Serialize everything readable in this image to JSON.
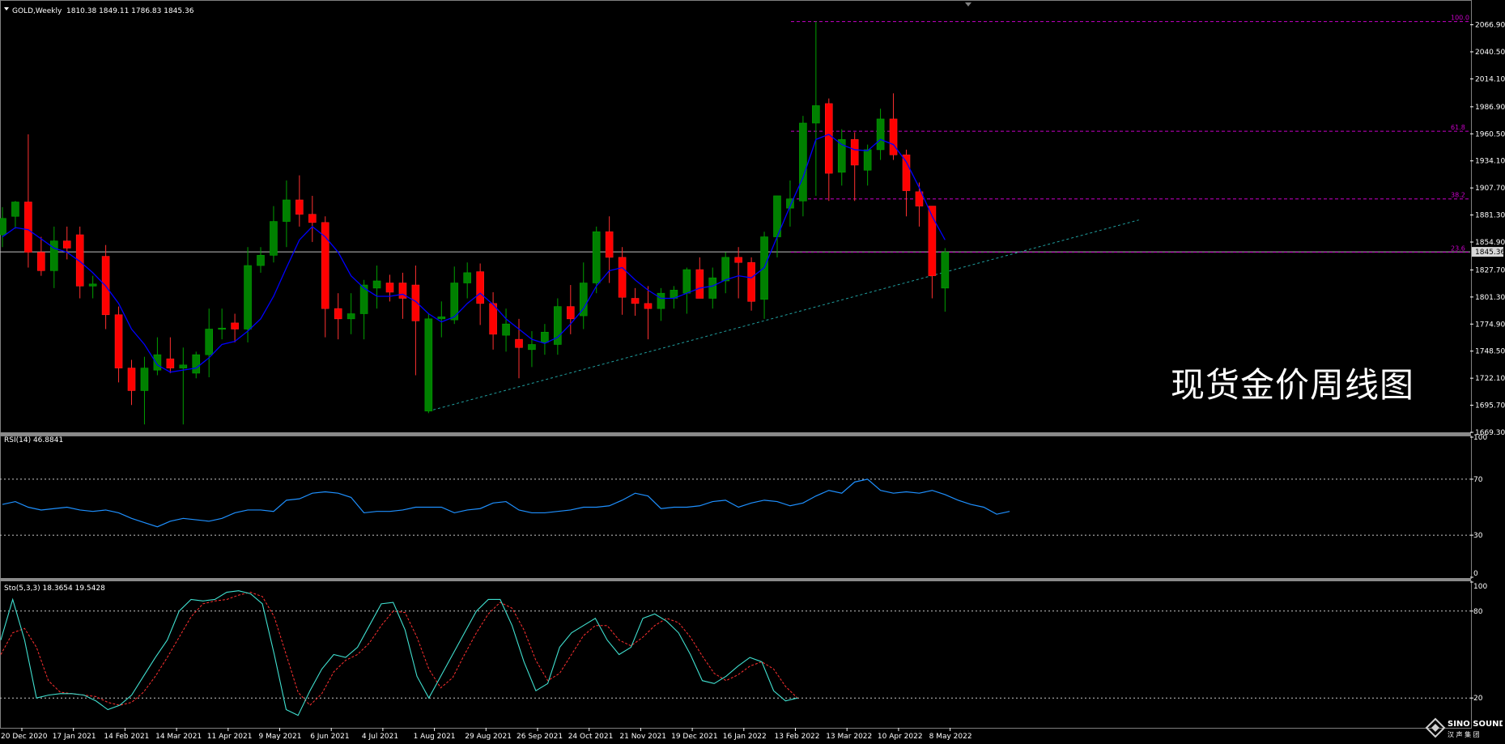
{
  "header": {
    "symbol_label": "GOLD,Weekly",
    "ohlc_label": "1810.38 1849.11 1786.83 1845.36"
  },
  "watermark": "现货金价周线图",
  "logo": {
    "text": "SINO SOUND",
    "subtext": "汉 声 集 团"
  },
  "colors": {
    "background": "#000000",
    "bull_candle": "#008000",
    "bear_candle": "#ff0000",
    "ma_line": "#0000ff",
    "fib_line": "#c800c8",
    "trend_line": "#20a0a0",
    "rsi_line": "#1e90ff",
    "stoch_main": "#40e0d0",
    "stoch_signal": "#ff3030",
    "axis_text": "#ffffff",
    "price_marker": "#c0c0c0"
  },
  "chart_data": [
    {
      "type": "candlestick",
      "panel": "price",
      "ylim": [
        1669.3,
        2080
      ],
      "yticks": [
        "2066.90",
        "2040.50",
        "2014.10",
        "1986.90",
        "1960.50",
        "1934.10",
        "1907.70",
        "1881.30",
        "1854.90",
        "1827.70",
        "1801.30",
        "1774.90",
        "1748.50",
        "1722.10",
        "1695.70",
        "1669.30"
      ],
      "current_price": "1845.36",
      "xticks": [
        "20 Dec 2020",
        "17 Jan 2021",
        "14 Feb 2021",
        "14 Mar 2021",
        "11 Apr 2021",
        "9 May 2021",
        "6 Jun 2021",
        "4 Jul 2021",
        "1 Aug 2021",
        "29 Aug 2021",
        "26 Sep 2021",
        "24 Oct 2021",
        "21 Nov 2021",
        "19 Dec 2021",
        "16 Jan 2022",
        "13 Feb 2022",
        "13 Mar 2022",
        "10 Apr 2022",
        "8 May 2022"
      ],
      "ohlc": [
        [
          1862,
          1889,
          1850,
          1878
        ],
        [
          1880,
          1895,
          1868,
          1894
        ],
        [
          1894,
          1960,
          1830,
          1845
        ],
        [
          1845,
          1860,
          1822,
          1827
        ],
        [
          1827,
          1870,
          1810,
          1856
        ],
        [
          1856,
          1870,
          1838,
          1849
        ],
        [
          1862,
          1870,
          1800,
          1812
        ],
        [
          1812,
          1822,
          1800,
          1814
        ],
        [
          1841,
          1852,
          1770,
          1784
        ],
        [
          1784,
          1792,
          1718,
          1732
        ],
        [
          1732,
          1740,
          1696,
          1710
        ],
        [
          1710,
          1743,
          1677,
          1732
        ],
        [
          1730,
          1762,
          1725,
          1745
        ],
        [
          1741,
          1762,
          1727,
          1732
        ],
        [
          1732,
          1752,
          1677,
          1735
        ],
        [
          1727,
          1748,
          1722,
          1745
        ],
        [
          1745,
          1790,
          1723,
          1770
        ],
        [
          1770,
          1790,
          1760,
          1771
        ],
        [
          1776,
          1785,
          1757,
          1770
        ],
        [
          1770,
          1850,
          1757,
          1832
        ],
        [
          1832,
          1850,
          1825,
          1842
        ],
        [
          1842,
          1890,
          1835,
          1875
        ],
        [
          1875,
          1915,
          1850,
          1896
        ],
        [
          1896,
          1920,
          1870,
          1882
        ],
        [
          1882,
          1900,
          1855,
          1874
        ],
        [
          1874,
          1880,
          1762,
          1790
        ],
        [
          1790,
          1805,
          1760,
          1780
        ],
        [
          1780,
          1805,
          1765,
          1785
        ],
        [
          1785,
          1818,
          1760,
          1813
        ],
        [
          1810,
          1832,
          1790,
          1817
        ],
        [
          1815,
          1823,
          1797,
          1806
        ],
        [
          1815,
          1825,
          1780,
          1800
        ],
        [
          1813,
          1832,
          1725,
          1778
        ],
        [
          1690,
          1785,
          1688,
          1780
        ],
        [
          1780,
          1797,
          1762,
          1782
        ],
        [
          1779,
          1831,
          1775,
          1815
        ],
        [
          1815,
          1835,
          1800,
          1825
        ],
        [
          1826,
          1834,
          1774,
          1795
        ],
        [
          1795,
          1806,
          1750,
          1765
        ],
        [
          1764,
          1790,
          1748,
          1775
        ],
        [
          1760,
          1780,
          1722,
          1752
        ],
        [
          1750,
          1768,
          1733,
          1755
        ],
        [
          1757,
          1775,
          1745,
          1767
        ],
        [
          1755,
          1800,
          1745,
          1792
        ],
        [
          1792,
          1813,
          1765,
          1780
        ],
        [
          1783,
          1835,
          1770,
          1815
        ],
        [
          1815,
          1870,
          1805,
          1865
        ],
        [
          1865,
          1880,
          1815,
          1840
        ],
        [
          1840,
          1850,
          1784,
          1801
        ],
        [
          1800,
          1810,
          1783,
          1795
        ],
        [
          1795,
          1812,
          1760,
          1790
        ],
        [
          1790,
          1810,
          1778,
          1805
        ],
        [
          1800,
          1812,
          1790,
          1808
        ],
        [
          1805,
          1830,
          1785,
          1828
        ],
        [
          1828,
          1840,
          1800,
          1800
        ],
        [
          1800,
          1830,
          1790,
          1820
        ],
        [
          1817,
          1845,
          1805,
          1840
        ],
        [
          1840,
          1850,
          1800,
          1835
        ],
        [
          1835,
          1840,
          1788,
          1797
        ],
        [
          1799,
          1865,
          1780,
          1860
        ],
        [
          1860,
          1900,
          1840,
          1900
        ],
        [
          1888,
          1915,
          1870,
          1897
        ],
        [
          1895,
          1978,
          1880,
          1971
        ],
        [
          1971,
          2070,
          1900,
          1988
        ],
        [
          1990,
          1995,
          1895,
          1922
        ],
        [
          1923,
          1965,
          1910,
          1955
        ],
        [
          1955,
          1962,
          1895,
          1930
        ],
        [
          1925,
          1950,
          1910,
          1945
        ],
        [
          1945,
          1985,
          1935,
          1975
        ],
        [
          1975,
          2000,
          1935,
          1940
        ],
        [
          1940,
          1945,
          1880,
          1905
        ],
        [
          1904,
          1913,
          1870,
          1890
        ],
        [
          1890,
          1890,
          1800,
          1822
        ],
        [
          1810,
          1849,
          1787,
          1845
        ]
      ],
      "ma": [
        1860,
        1869,
        1867,
        1858,
        1849,
        1845,
        1836,
        1825,
        1812,
        1795,
        1770,
        1755,
        1735,
        1728,
        1730,
        1732,
        1742,
        1755,
        1758,
        1768,
        1780,
        1802,
        1830,
        1857,
        1870,
        1860,
        1845,
        1822,
        1810,
        1802,
        1802,
        1804,
        1797,
        1785,
        1777,
        1782,
        1795,
        1805,
        1794,
        1780,
        1770,
        1760,
        1756,
        1762,
        1775,
        1790,
        1812,
        1827,
        1830,
        1818,
        1808,
        1800,
        1800,
        1805,
        1810,
        1812,
        1818,
        1822,
        1820,
        1830,
        1860,
        1890,
        1918,
        1955,
        1960,
        1950,
        1945,
        1944,
        1955,
        1950,
        1933,
        1908,
        1880,
        1857
      ],
      "fib_levels": [
        {
          "label": "100.0",
          "price": 2070
        },
        {
          "label": "61.8",
          "price": 1963
        },
        {
          "label": "38.2",
          "price": 1897
        },
        {
          "label": "23.6",
          "price": 1845
        }
      ],
      "trendline": {
        "from": [
          33,
          1690
        ],
        "to": [
          85,
          1882
        ]
      }
    },
    {
      "type": "line",
      "panel": "rsi",
      "label": "RSI(14) 46.8841",
      "ylim": [
        0,
        100
      ],
      "yticks": [
        "100",
        "70",
        "30",
        "0"
      ],
      "levels": [
        70,
        30
      ],
      "values": [
        52,
        54,
        50,
        48,
        49,
        50,
        48,
        47,
        48,
        46,
        42,
        39,
        36,
        40,
        42,
        41,
        40,
        42,
        46,
        48,
        48,
        47,
        55,
        56,
        60,
        61,
        60,
        57,
        46,
        47,
        47,
        48,
        50,
        50,
        50,
        46,
        48,
        49,
        53,
        54,
        48,
        46,
        46,
        47,
        48,
        50,
        50,
        51,
        55,
        60,
        58,
        49,
        50,
        50,
        51,
        54,
        55,
        50,
        53,
        55,
        54,
        51,
        53,
        58,
        62,
        60,
        68,
        70,
        62,
        60,
        61,
        60,
        62,
        59,
        55,
        52,
        50,
        45,
        47
      ]
    },
    {
      "type": "line",
      "panel": "stochastic",
      "label": "Sto(5,3,3) 18.3654 19.5428",
      "ylim": [
        0,
        100
      ],
      "yticks": [
        "100",
        "80",
        "20"
      ],
      "levels": [
        80,
        20
      ],
      "main": [
        60,
        88,
        60,
        20,
        22,
        23,
        23,
        22,
        18,
        12,
        15,
        22,
        35,
        48,
        60,
        80,
        88,
        87,
        88,
        93,
        94,
        92,
        85,
        50,
        12,
        8,
        25,
        40,
        50,
        48,
        55,
        70,
        85,
        86,
        67,
        35,
        20,
        35,
        50,
        65,
        80,
        88,
        88,
        70,
        45,
        25,
        30,
        55,
        65,
        70,
        75,
        60,
        50,
        55,
        75,
        78,
        73,
        65,
        50,
        32,
        30,
        35,
        42,
        48,
        45,
        25,
        18,
        20
      ],
      "signal": [
        50,
        65,
        68,
        55,
        32,
        24,
        23,
        22,
        21,
        17,
        15,
        17,
        24,
        35,
        48,
        62,
        76,
        85,
        87,
        88,
        91,
        93,
        90,
        76,
        50,
        24,
        15,
        23,
        38,
        46,
        50,
        58,
        70,
        80,
        79,
        62,
        40,
        27,
        34,
        50,
        65,
        78,
        86,
        82,
        67,
        46,
        32,
        37,
        50,
        63,
        70,
        70,
        60,
        56,
        62,
        70,
        75,
        72,
        62,
        49,
        37,
        32,
        36,
        42,
        45,
        40,
        28,
        20
      ]
    }
  ]
}
